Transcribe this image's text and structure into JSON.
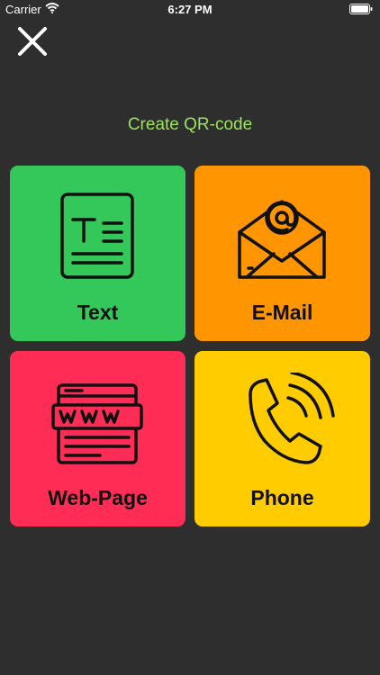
{
  "status_bar": {
    "carrier": "Carrier",
    "time": "6:27 PM"
  },
  "header": {
    "title": "Create QR-code"
  },
  "tiles": [
    {
      "label": "Text",
      "icon": "text-document-icon",
      "color": "#34c759"
    },
    {
      "label": "E-Mail",
      "icon": "email-envelope-icon",
      "color": "#ff9500"
    },
    {
      "label": "Web-Page",
      "icon": "web-page-icon",
      "color": "#ff2d55"
    },
    {
      "label": "Phone",
      "icon": "phone-icon",
      "color": "#ffcc00"
    }
  ],
  "colors": {
    "background": "#2e2e2e",
    "title": "#9be35a"
  }
}
